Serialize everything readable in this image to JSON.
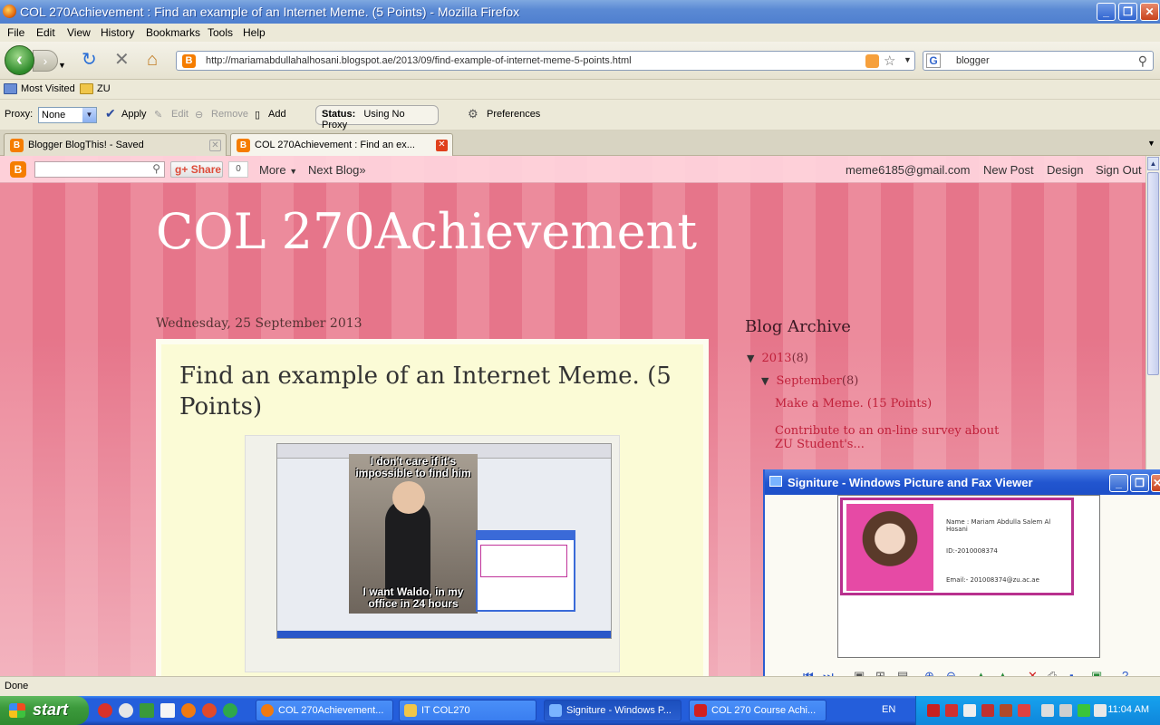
{
  "window": {
    "title": "COL 270Achievement : Find an example of an Internet Meme. (5 Points) - Mozilla Firefox"
  },
  "menu": [
    "File",
    "Edit",
    "View",
    "History",
    "Bookmarks",
    "Tools",
    "Help"
  ],
  "navbar": {
    "url": "http://mariamabdullahalhosani.blogspot.ae/2013/09/find-example-of-internet-meme-5-points.html",
    "search_value": "blogger"
  },
  "bookmarks": [
    "Most Visited",
    "ZU"
  ],
  "proxybar": {
    "label": "Proxy:",
    "selected": "None",
    "apply": "Apply",
    "edit": "Edit",
    "remove": "Remove",
    "add": "Add",
    "status_label": "Status:",
    "status_value": "Using No Proxy",
    "preferences": "Preferences"
  },
  "tabs": [
    {
      "label": "Blogger BlogThis! - Saved"
    },
    {
      "label": "COL 270Achievement : Find an ex..."
    }
  ],
  "blogger_bar": {
    "share": "Share",
    "count": "0",
    "more": "More",
    "next_blog": "Next Blog»",
    "email": "meme6185@gmail.com",
    "new_post": "New Post",
    "design": "Design",
    "sign_out": "Sign Out"
  },
  "blog": {
    "title": "COL 270Achievement",
    "date": "Wednesday, 25 September 2013",
    "post_title": "Find an example of an Internet Meme. (5 Points)",
    "meme_top": "I don't care if it's impossible to find him",
    "meme_bottom": "I want Waldo, in my office in 24 hours"
  },
  "sidebar": {
    "archive_title": "Blog Archive",
    "year": {
      "label": "2013",
      "count": "(8)"
    },
    "month": {
      "label": "September",
      "count": "(8)"
    },
    "posts": [
      "Make a Meme. (15 Points)",
      "Contribute to an on-line survey about ZU Student's..."
    ]
  },
  "viewer": {
    "title": "Signiture - Windows Picture and Fax Viewer",
    "card_name": "Name : Mariam Abdulla Salem Al Hosani",
    "card_id": "ID:-2010008374",
    "card_email": "Email:- 201008374@zu.ac.ae"
  },
  "status": "Done",
  "taskbar": {
    "start": "start",
    "tasks": [
      "COL 270Achievement...",
      "IT COL270",
      "Signiture - Windows P...",
      "COL 270 Course Achi..."
    ],
    "lang": "EN",
    "time": "11:04 AM"
  },
  "colors": {
    "stripe_light": "#ec8b9c",
    "stripe_dark": "#e6758a",
    "post_bg": "#fbfbd6",
    "archive_link": "#c0203a",
    "xp_blue": "#245edb"
  }
}
